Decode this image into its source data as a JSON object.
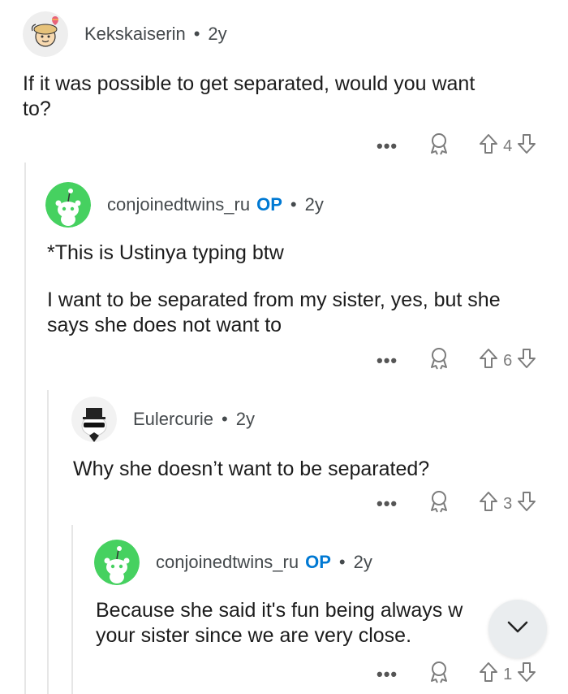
{
  "comments": [
    {
      "author": "Kekskaiserin",
      "op": "",
      "time": "2y",
      "text": [
        "If it was possible to get separated, would you want",
        "to?"
      ],
      "score": "4",
      "more": "•••"
    },
    {
      "author": "conjoinedtwins_ru",
      "op": "OP",
      "time": "2y",
      "text": [
        "*This is Ustinya typing btw"
      ],
      "text2": [
        "I want to be separated from my sister, yes, but she",
        "says she does not want to"
      ],
      "score": "6",
      "more": "•••"
    },
    {
      "author": "Eulercurie",
      "op": "",
      "time": "2y",
      "text": [
        "Why she doesn’t want to be separated?"
      ],
      "score": "3",
      "more": "•••"
    },
    {
      "author": "conjoinedtwins_ru",
      "op": "OP",
      "time": "2y",
      "text": [
        "Because she said it's fun being always w",
        "your sister since we are very close."
      ],
      "score": "1",
      "more": "•••"
    }
  ],
  "separator": "•",
  "icons": {
    "more": "more-icon",
    "award": "award-icon",
    "upvote": "upvote-arrow-icon",
    "downvote": "downvote-arrow-icon",
    "scroll": "chevron-down-icon"
  },
  "colors": {
    "op": "#0079d3",
    "snoo_bg": "#46d160",
    "meta": "#454a4d"
  }
}
